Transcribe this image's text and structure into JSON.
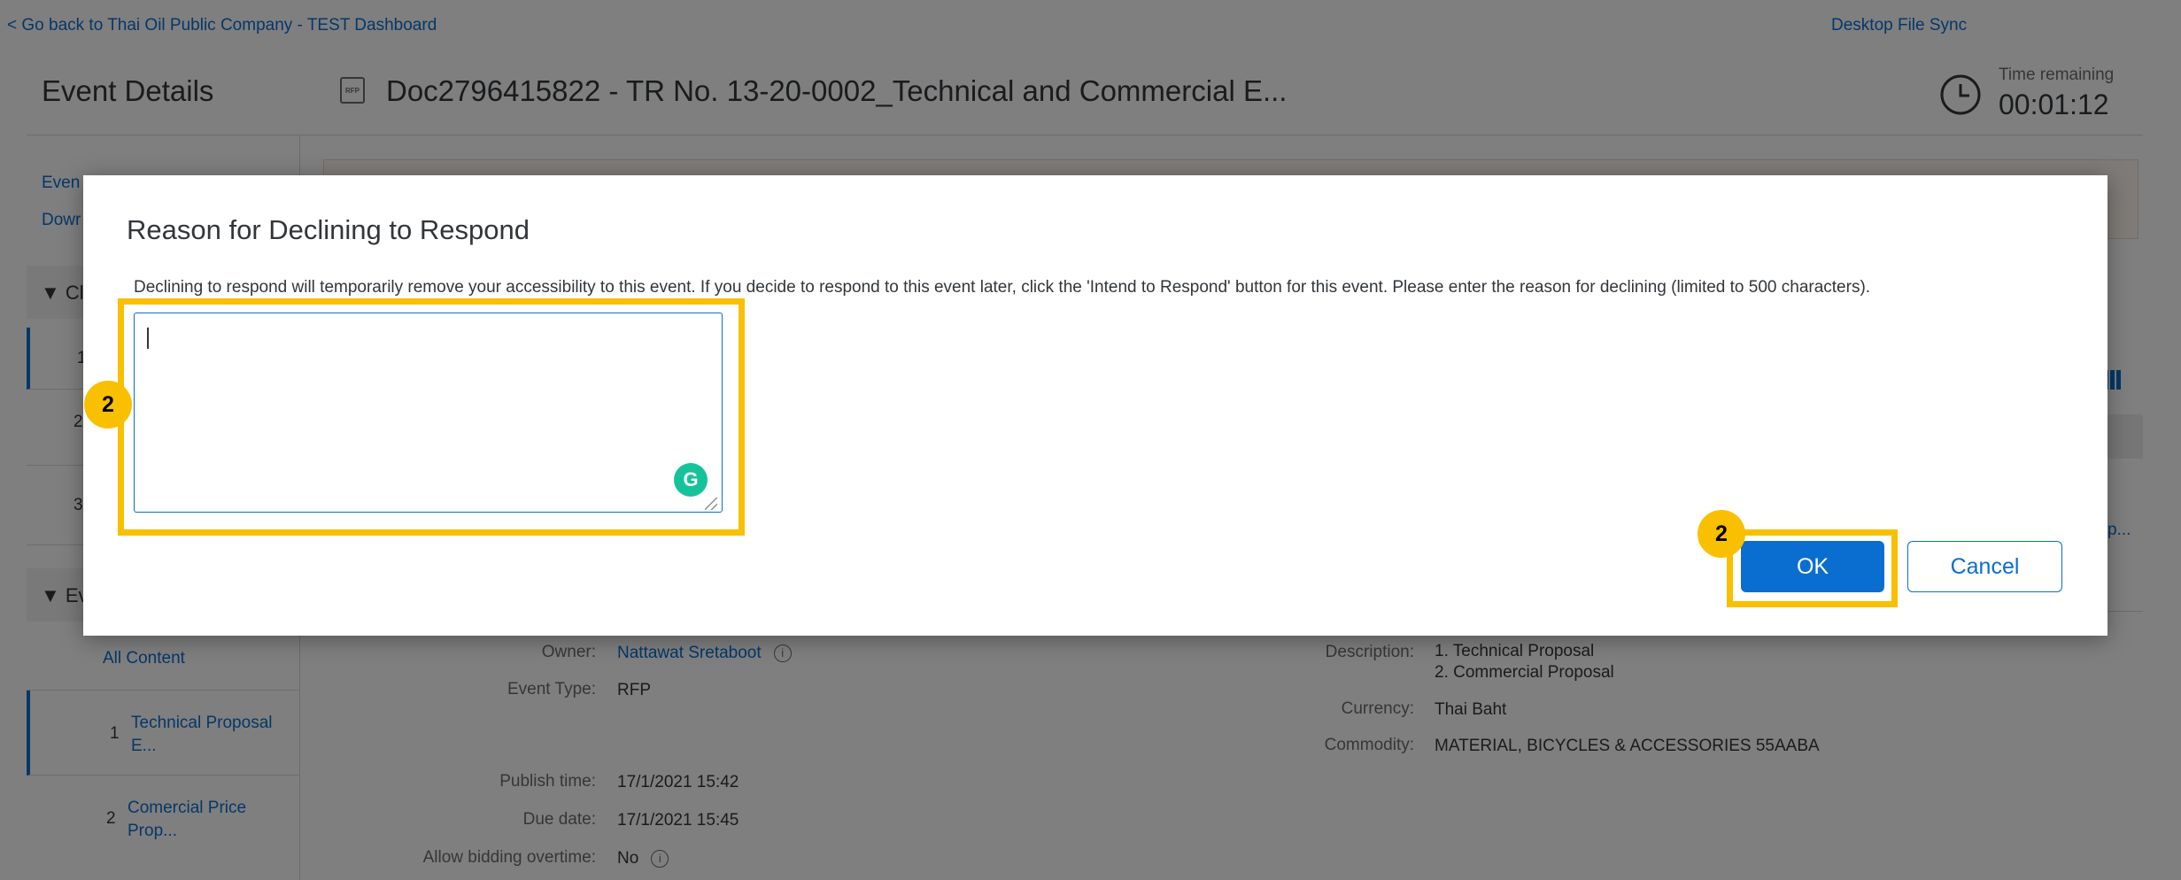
{
  "page": {
    "back_link": "< Go back to Thai Oil Public Company - TEST Dashboard",
    "desktop_sync": "Desktop File Sync",
    "section_title": "Event Details",
    "doc_icon_text": "RFP",
    "doc_title": "Doc2796415822 - TR No. 13-20-0002_Technical and Commercial E...",
    "time_remaining_label": "Time remaining",
    "time_remaining_value": "00:01:12"
  },
  "sidebar": {
    "link1": "Even",
    "link2": "Dowr",
    "section1": "▼ Cl",
    "items1": [
      "1",
      "2",
      "3"
    ],
    "section2": "▼ Ev",
    "all_content": "All Content",
    "items2": [
      {
        "num": "1",
        "label_line1": "Technical Proposal",
        "label_line2": "E..."
      },
      {
        "num": "2",
        "label_line1": "Comercial Price",
        "label_line2": "Prop..."
      }
    ]
  },
  "details": {
    "owner_label": "Owner:",
    "owner_value": "Nattawat Sretaboot",
    "event_type_label": "Event Type:",
    "event_type_value": "RFP",
    "publish_label": "Publish time:",
    "publish_value": "17/1/2021 15:42",
    "due_label": "Due date:",
    "due_value": "17/1/2021 15:45",
    "overtime_label": "Allow bidding overtime:",
    "overtime_value": "No",
    "description_label": "Description:",
    "description_line1": "1. Technical Proposal",
    "description_line2": "2. Commercial Proposal",
    "currency_label": "Currency:",
    "currency_value": "Thai Baht",
    "commodity_label": "Commodity:",
    "commodity_value": "MATERIAL, BICYCLES & ACCESSORIES 55AABA",
    "truncated_link": "p..."
  },
  "dialog": {
    "title": "Reason for Declining to Respond",
    "message": "Declining to respond will temporarily remove your accessibility to this event. If you decide to respond to this event later, click the 'Intend to Respond' button for this event. Please enter the reason for declining (limited to 500 characters).",
    "reason_value": "",
    "ok_label": "OK",
    "cancel_label": "Cancel"
  },
  "callouts": {
    "textarea_step": "2",
    "ok_step": "2"
  },
  "colors": {
    "accent": "#0a6ed1",
    "highlight": "#f9c000",
    "grammarly": "#15c39a"
  },
  "icons": [
    "document-rfp-icon",
    "clock-icon",
    "info-icon",
    "grammarly-icon",
    "resize-grip-icon",
    "grid-view-icon"
  ]
}
